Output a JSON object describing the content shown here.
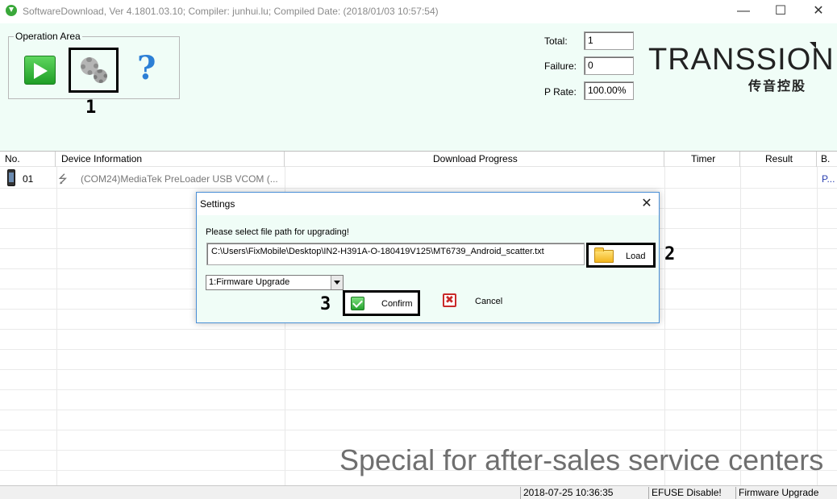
{
  "window": {
    "title": "SoftwareDownload, Ver 4.1801.03.10; Compiler: junhui.lu; Compiled Date: (2018/01/03 10:57:54)",
    "minimize": "—",
    "maximize": "☐",
    "close": "✕"
  },
  "operation_area": {
    "legend": "Operation Area",
    "help_glyph": "?",
    "annotation": "1"
  },
  "stats": {
    "total_label": "Total:",
    "total_value": "1",
    "failure_label": "Failure:",
    "failure_value": "0",
    "prate_label": "P Rate:",
    "prate_value": "100.00%"
  },
  "logo": {
    "name": "TRANSSION",
    "subtitle": "传音控股"
  },
  "grid": {
    "columns": [
      "No.",
      "Device Information",
      "Download Progress",
      "Timer",
      "Result",
      "B."
    ],
    "rows": [
      {
        "no": "01",
        "device": "(COM24)MediaTek PreLoader USB VCOM (...",
        "progress": "",
        "timer": "",
        "result": "",
        "b": "P..."
      }
    ]
  },
  "watermark": "Special for after-sales service centers",
  "statusbar": {
    "datetime": "2018-07-25 10:36:35",
    "efuse": "EFUSE Disable!",
    "mode": "Firmware Upgrade"
  },
  "settings_dialog": {
    "title": "Settings",
    "close_glyph": "✕",
    "prompt": "Please select file path for upgrading!",
    "path_value": "C:\\Users\\FixMobile\\Desktop\\IN2-H391A-O-180419V125\\MT6739_Android_scatter.txt",
    "load_label": "Load",
    "load_annotation": "2",
    "mode_selected": "1:Firmware Upgrade",
    "confirm_label": "Confirm",
    "confirm_annotation": "3",
    "cancel_label": "Cancel",
    "cancel_glyph": "✖"
  },
  "colors": {
    "panel_bg": "#f0fdf7",
    "dialog_border": "#4a8fd6",
    "start_green": "#1f9e26",
    "help_blue": "#2c7fd6",
    "b_column_text": "#2a3fb0"
  },
  "icons": {
    "app": "download-arrow-icon",
    "start": "play-icon",
    "settings": "gear-icon",
    "help": "question-mark-icon",
    "device": "phone-icon",
    "usb": "usb-icon",
    "load": "folder-icon",
    "confirm": "check-icon",
    "cancel": "x-icon"
  }
}
